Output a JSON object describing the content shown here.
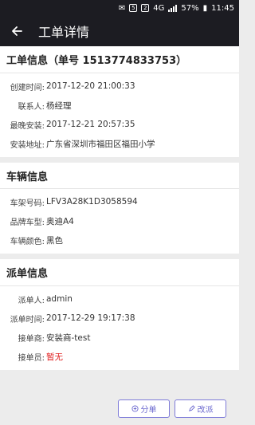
{
  "status_bar": {
    "badge1": "5",
    "badge2": "2",
    "network": "4G",
    "battery": "57%",
    "time": "11:45"
  },
  "app_bar": {
    "title": "工单详情"
  },
  "order_info": {
    "title": "工单信息（单号 1513774833753）",
    "rows": [
      {
        "label": "创建时间:",
        "value": "2017-12-20 21:00:33"
      },
      {
        "label": "联系人:",
        "value": "杨经理"
      },
      {
        "label": "最晚安装:",
        "value": "2017-12-21 20:57:35"
      },
      {
        "label": "安装地址:",
        "value": "广东省深圳市福田区福田小学"
      }
    ]
  },
  "vehicle_info": {
    "title": "车辆信息",
    "rows": [
      {
        "label": "车架号码:",
        "value": "LFV3A28K1D3058594"
      },
      {
        "label": "品牌车型:",
        "value": "奥迪A4"
      },
      {
        "label": "车辆颜色:",
        "value": "黑色"
      }
    ]
  },
  "dispatch_info": {
    "title": "派单信息",
    "rows": [
      {
        "label": "派单人:",
        "value": "admin"
      },
      {
        "label": "派单时间:",
        "value": "2017-12-29 19:17:38"
      },
      {
        "label": "接单商:",
        "value": "安装商-test"
      },
      {
        "label": "接单员:",
        "value": "暂无"
      }
    ]
  },
  "actions": {
    "dispatch_label": "分单",
    "reassign_label": "改派"
  },
  "colors": {
    "header_bg": "#1c1c22",
    "accent": "#6b68cf",
    "warning": "#e02020"
  }
}
